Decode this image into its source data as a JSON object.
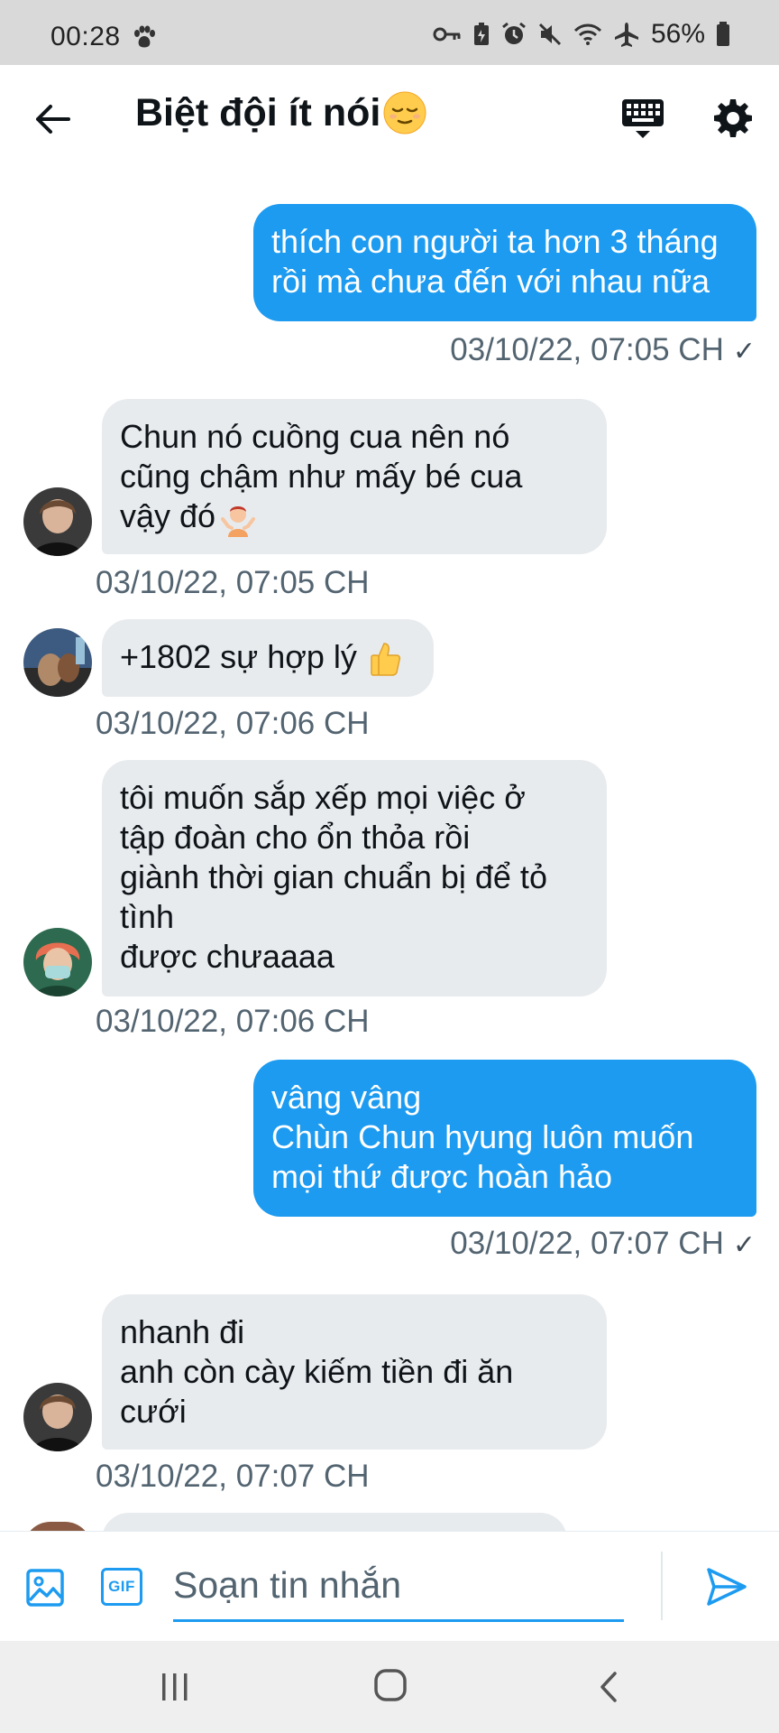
{
  "status_bar": {
    "time": "00:28",
    "battery": "56%",
    "icons": [
      "paw-icon",
      "key-icon",
      "battery-saver-icon",
      "alarm-icon",
      "mute-icon",
      "wifi-icon",
      "airplane-icon",
      "battery-icon"
    ]
  },
  "header": {
    "title": "Biệt đội ít nói",
    "title_emoji": "relieved-face-emoji",
    "icons": [
      "back-arrow-icon",
      "keyboard-icon",
      "gear-icon"
    ]
  },
  "messages": [
    {
      "direction": "outgoing",
      "lines": [
        "thích con người ta hơn 3 tháng",
        "rồi mà chưa đến với nhau nữa"
      ],
      "time": "03/10/22, 07:05 CH",
      "read_mark": "✓"
    },
    {
      "direction": "incoming",
      "lines": [
        "Chun nó cuồng cua nên nó",
        "cũng chậm như mấy bé cua",
        "vậy đó"
      ],
      "emoji": "person-shrugging-emoji",
      "time": "03/10/22, 07:05 CH",
      "avatar": "avatar-a"
    },
    {
      "direction": "incoming",
      "lines": [
        "+1802 sự hợp lý"
      ],
      "emoji": "thumbs-up-emoji",
      "time": "03/10/22, 07:06 CH",
      "avatar": "avatar-b"
    },
    {
      "direction": "incoming",
      "lines": [
        "tôi muốn sắp xếp mọi việc ở",
        "tập đoàn cho ổn thỏa rồi",
        "giành thời gian chuẩn bị để tỏ",
        "tình",
        "được chưaaaa"
      ],
      "time": "03/10/22, 07:06 CH",
      "avatar": "avatar-c"
    },
    {
      "direction": "outgoing",
      "lines": [
        "vâng vâng",
        "Chùn Chun hyung luôn muốn",
        "mọi thứ được hoàn hảo"
      ],
      "time": "03/10/22, 07:07 CH",
      "read_mark": "✓"
    },
    {
      "direction": "incoming",
      "lines": [
        "nhanh đi",
        "anh còn cày kiếm tiền đi ăn",
        "cưới"
      ],
      "time": "03/10/22, 07:07 CH",
      "avatar": "avatar-a"
    }
  ],
  "composer": {
    "placeholder": "Soạn tin nhắn",
    "gif_label": "GIF",
    "icons": [
      "image-icon",
      "gif-icon",
      "send-icon"
    ]
  },
  "nav_bar": {
    "icons": [
      "recents-icon",
      "home-icon",
      "nav-back-icon"
    ]
  },
  "colors": {
    "accent": "#1d9bf0",
    "incoming_bubble": "#e8ebee",
    "timestamp": "#536471"
  }
}
